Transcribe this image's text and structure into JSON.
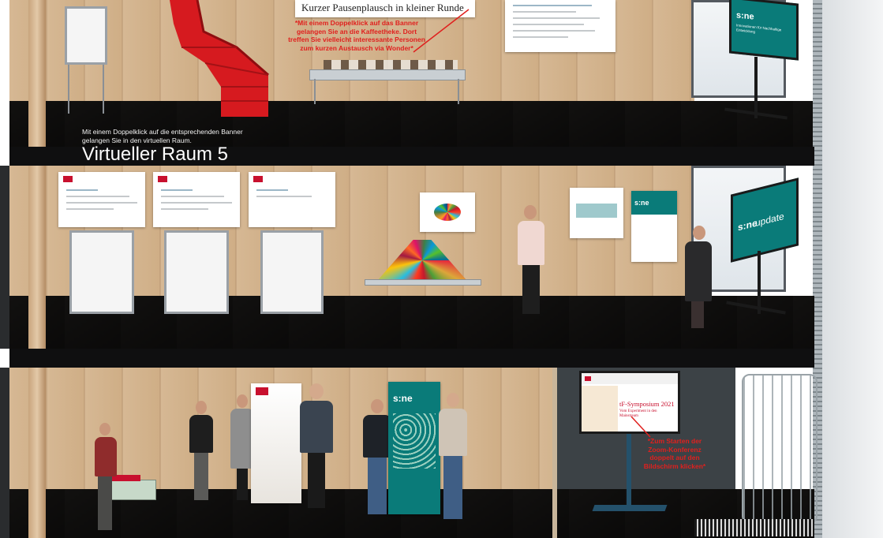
{
  "floor_top": {
    "banner_title": "Kurzer Pausenplausch in kleiner Runde",
    "coffee_hint": "*Mit einem Doppelklick auf das Banner gelangen Sie an die Kaffeetheke. Dort treffen Sie vielleicht interessante Personen zum kurzen Austausch via Wonder*",
    "screen_brand": "s:ne",
    "screen_subtitle": "Innovationen für Nachhaltige Entwicklung"
  },
  "room_label": {
    "hint": "Mit einem Doppelklick auf die entsprechenden Banner gelangen Sie in den virtuellen Raum.",
    "title": "Virtueller Raum 5"
  },
  "floor_middle": {
    "screen_brand": "s:ne",
    "screen_text": "update",
    "poster_brand": "s:ne"
  },
  "floor_bottom": {
    "rollup_brand": "s:ne",
    "zoom_screen_title": "tF-Symposium 2021",
    "zoom_screen_subtitle": "Vom Experiment in den Mainstream",
    "zoom_hint": "*Zum Starten der Zoom-Konferenz doppelt auf den Bildschirm klicken*"
  },
  "colors": {
    "accent_teal": "#0a7b79",
    "hint_red": "#e0201e",
    "band": "#0f0f10",
    "wall_wood": "#d6b894"
  },
  "icons": [
    "red-spiral-staircase",
    "flipchart",
    "coffee-table",
    "tv-screen-on-stand",
    "poster-banner",
    "sdg-cube-pyramid",
    "roll-up-banner"
  ]
}
